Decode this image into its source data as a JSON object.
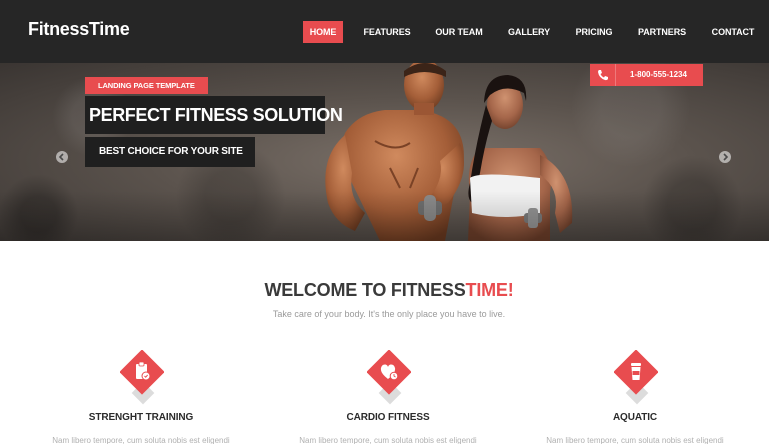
{
  "header": {
    "brand": "FitnessTime",
    "nav": [
      {
        "label": "HOME",
        "active": true
      },
      {
        "label": "FEATURES",
        "active": false
      },
      {
        "label": "OUR TEAM",
        "active": false
      },
      {
        "label": "GALLERY",
        "active": false
      },
      {
        "label": "PRICING",
        "active": false
      },
      {
        "label": "PARTNERS",
        "active": false
      },
      {
        "label": "CONTACT",
        "active": false
      }
    ]
  },
  "hero": {
    "tag": "LANDING PAGE TEMPLATE",
    "title": "PERFECT FITNESS SOLUTION",
    "subtitle": "BEST CHOICE FOR YOUR SITE",
    "phone": "1-800-555-1234",
    "phone_icon": "phone-icon",
    "prev_icon": "chevron-left-icon",
    "next_icon": "chevron-right-icon"
  },
  "welcome": {
    "title_main": "WELCOME TO FITNESS",
    "title_accent": "TIME!",
    "subtitle": "Take care of your body. It's the only place you have to live."
  },
  "features": [
    {
      "icon": "clipboard-icon",
      "title": "STRENGHT TRAINING",
      "text": "Nam libero tempore, cum soluta nobis est eligendi"
    },
    {
      "icon": "heart-icon",
      "title": "CARDIO FITNESS",
      "text": "Nam libero tempore, cum soluta nobis est eligendi"
    },
    {
      "icon": "drink-icon",
      "title": "AQUATIC",
      "text": "Nam libero tempore, cum soluta nobis est eligendi"
    }
  ],
  "colors": {
    "accent": "#e84c4f",
    "header_bg": "#262626",
    "dark_box": "#1f1f1f"
  }
}
